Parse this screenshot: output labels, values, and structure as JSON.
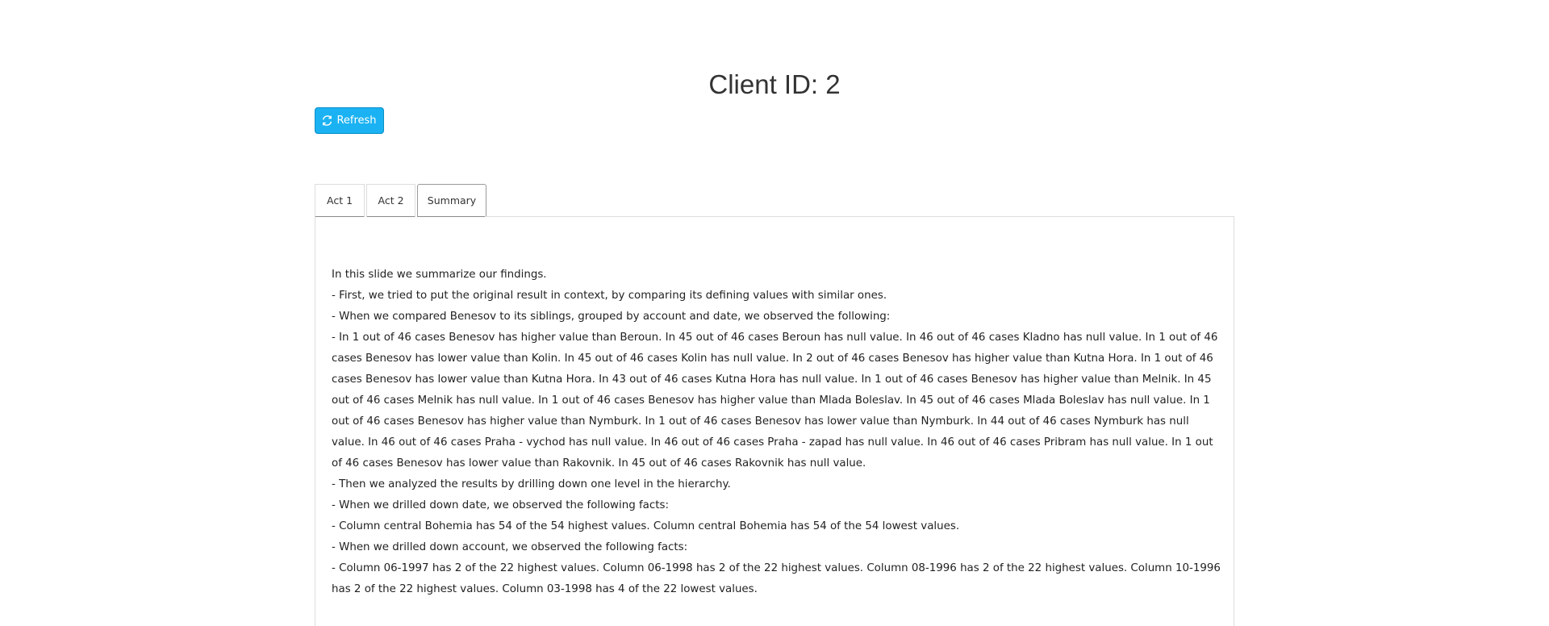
{
  "header": {
    "title": "Client ID: 2"
  },
  "toolbar": {
    "refresh_label": "Refresh",
    "refresh_icon": "refresh-icon",
    "refresh_color": "#1ab2f2"
  },
  "tabs": [
    {
      "label": "Act 1"
    },
    {
      "label": "Act 2"
    },
    {
      "label": "Summary",
      "active": true
    }
  ],
  "summary": {
    "lines": [
      "In this slide we summarize our findings.",
      "- First, we tried to put the original result in context, by comparing its defining values with similar ones.",
      "- When we compared Benesov to its siblings, grouped by account and date, we observed the following:",
      "- In 1 out of 46 cases Benesov has higher value than Beroun. In 45 out of 46 cases Beroun has null value. In 46 out of 46 cases Kladno has null value. In 1 out of 46 cases Benesov has lower value than Kolin. In 45 out of 46 cases Kolin has null value. In 2 out of 46 cases Benesov has higher value than Kutna Hora. In 1 out of 46 cases Benesov has lower value than Kutna Hora. In 43 out of 46 cases Kutna Hora has null value. In 1 out of 46 cases Benesov has higher value than Melnik. In 45 out of 46 cases Melnik has null value. In 1 out of 46 cases Benesov has higher value than Mlada Boleslav. In 45 out of 46 cases Mlada Boleslav has null value. In 1 out of 46 cases Benesov has higher value than Nymburk. In 1 out of 46 cases Benesov has lower value than Nymburk. In 44 out of 46 cases Nymburk has null value. In 46 out of 46 cases Praha - vychod has null value. In 46 out of 46 cases Praha - zapad has null value. In 46 out of 46 cases Pribram has null value. In 1 out of 46 cases Benesov has lower value than Rakovnik. In 45 out of 46 cases Rakovnik has null value.",
      "- Then we analyzed the results by drilling down one level in the hierarchy.",
      "- When we drilled down date, we observed the following facts:",
      "- Column central Bohemia has 54 of the 54 highest values. Column central Bohemia has 54 of the 54 lowest values.",
      "- When we drilled down account, we observed the following facts:",
      "- Column 06-1997 has 2 of the 22 highest values. Column 06-1998 has 2 of the 22 highest values. Column 08-1996 has 2 of the 22 highest values. Column 10-1996 has 2 of the 22 highest values. Column 03-1998 has 4 of the 22 lowest values."
    ]
  }
}
